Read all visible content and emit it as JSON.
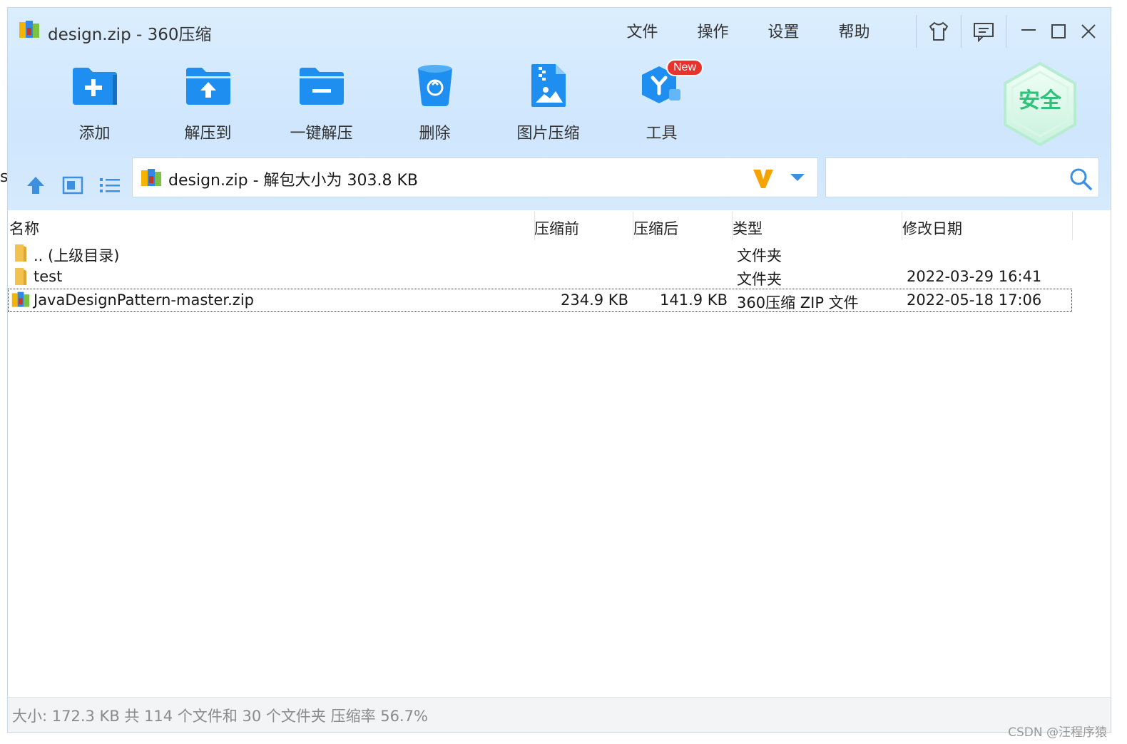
{
  "window": {
    "title": "design.zip - 360压缩"
  },
  "menu": [
    {
      "label": "文件"
    },
    {
      "label": "操作"
    },
    {
      "label": "设置"
    },
    {
      "label": "帮助"
    }
  ],
  "window_controls": [
    "skin-icon",
    "feedback-icon",
    "minimize-icon",
    "maximize-icon",
    "close-icon"
  ],
  "toolbar": {
    "items": [
      {
        "label": "添加",
        "icon": "add-folder-icon"
      },
      {
        "label": "解压到",
        "icon": "extract-to-icon"
      },
      {
        "label": "一键解压",
        "icon": "one-click-extract-icon"
      },
      {
        "label": "删除",
        "icon": "recycle-bin-icon"
      },
      {
        "label": "图片压缩",
        "icon": "image-compress-icon"
      },
      {
        "label": "工具",
        "icon": "tools-icon",
        "badge": "New"
      }
    ]
  },
  "security": {
    "label": "安全"
  },
  "path": {
    "text": "design.zip - 解包大小为 303.8 KB"
  },
  "search": {
    "value": "",
    "placeholder": ""
  },
  "table": {
    "columns": [
      "名称",
      "压缩前",
      "压缩后",
      "类型",
      "修改日期"
    ],
    "rows": [
      {
        "name": ".. (上级目录)",
        "before": "",
        "after": "",
        "type": "文件夹",
        "date": "",
        "icon": "folder-icon"
      },
      {
        "name": "test",
        "before": "",
        "after": "",
        "type": "文件夹",
        "date": "2022-03-29 16:41",
        "icon": "folder-icon"
      },
      {
        "name": "JavaDesignPattern-master.zip",
        "before": "234.9 KB",
        "after": "141.9 KB",
        "type": "360压缩 ZIP 文件",
        "date": "2022-05-18 17:06",
        "icon": "zip-archive-icon",
        "selected": true
      }
    ]
  },
  "status": {
    "text": "大小: 172.3 KB 共 114 个文件和 30 个文件夹 压缩率 56.7%"
  },
  "watermark": "CSDN @汪程序猿",
  "page_fragment_left": "s",
  "colors": {
    "accent": "#1a8cf0",
    "header_bg": "#d3e9fd",
    "badge_red": "#e8322e",
    "safe_green": "#2fc27a"
  }
}
